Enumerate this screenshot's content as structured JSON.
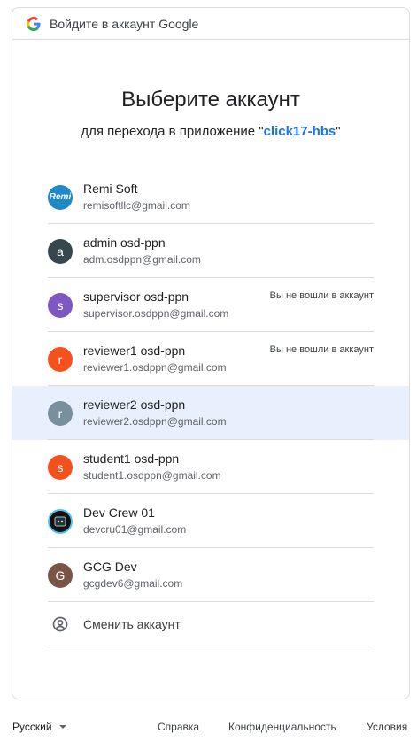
{
  "header": {
    "title": "Войдите в аккаунт Google"
  },
  "main": {
    "heading": "Выберите аккаунт",
    "subheading_prefix": "для перехода в приложение \"",
    "app_name": "click17-hbs",
    "subheading_suffix": "\""
  },
  "accounts": [
    {
      "avatar": "Remi",
      "name": "Remi Soft",
      "email": "remisoftllc@gmail.com",
      "status": "",
      "avatar_color": "#1e88c8"
    },
    {
      "avatar": "a",
      "name": "admin osd-ppn",
      "email": "adm.osdppn@gmail.com",
      "status": "",
      "avatar_color": "#37474f"
    },
    {
      "avatar": "s",
      "name": "supervisor osd-ppn",
      "email": "supervisor.osdppn@gmail.com",
      "status": "Вы не вошли в аккаунт",
      "avatar_color": "#7e57c2"
    },
    {
      "avatar": "r",
      "name": "reviewer1 osd-ppn",
      "email": "reviewer1.osdppn@gmail.com",
      "status": "Вы не вошли в аккаунт",
      "avatar_color": "#f4511e"
    },
    {
      "avatar": "r",
      "name": "reviewer2 osd-ppn",
      "email": "reviewer2.osdppn@gmail.com",
      "status": "",
      "avatar_color": "#78909c"
    },
    {
      "avatar": "s",
      "name": "student1 osd-ppn",
      "email": "student1.osdppn@gmail.com",
      "status": "",
      "avatar_color": "#f4511e"
    },
    {
      "avatar": "",
      "name": "Dev Crew 01",
      "email": "devcru01@gmail.com",
      "status": "",
      "avatar_color": "#111111"
    },
    {
      "avatar": "G",
      "name": "GCG Dev",
      "email": "gcgdev6@gmail.com",
      "status": "",
      "avatar_color": "#795548"
    }
  ],
  "switch_account": {
    "label": "Сменить аккаунт",
    "icon": "account-circle-icon"
  },
  "footer": {
    "language": "Русский",
    "help": "Справка",
    "privacy": "Конфиденциальность",
    "terms": "Условия"
  },
  "colors": {
    "accent": "#1a73e8",
    "highlight": "#e8f0fe"
  }
}
